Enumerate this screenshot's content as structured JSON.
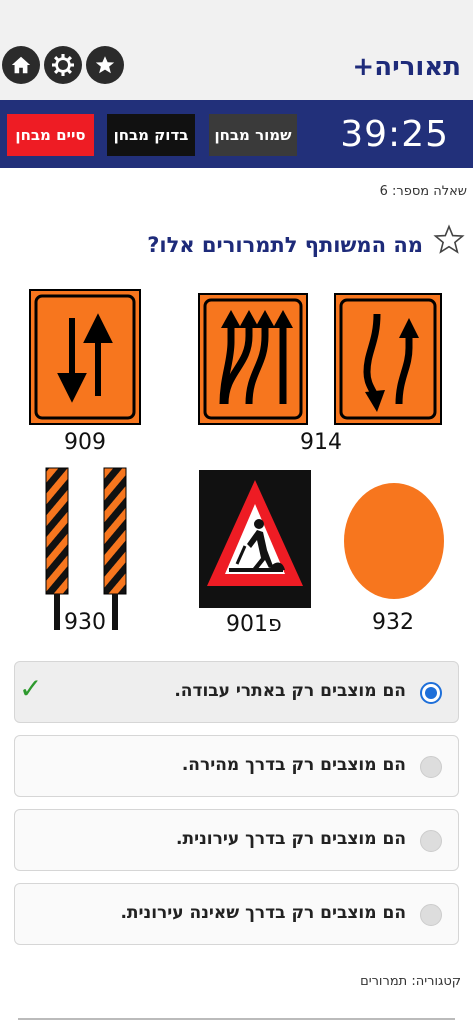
{
  "header": {
    "app_title": "תאוריה+",
    "icons": [
      "home-icon",
      "gear-icon",
      "star-icon"
    ]
  },
  "exam_bar": {
    "timer": "39:25",
    "save_label": "שמור מבחן",
    "check_label": "בדוק מבחן",
    "end_label": "סיים מבחן"
  },
  "question": {
    "number_label": "שאלה מספר: 6",
    "text": "מה המשותף לתמרורים אלו?"
  },
  "signs": [
    {
      "code": "909"
    },
    {
      "code": "914"
    },
    {
      "code": "930"
    },
    {
      "code": "901פ"
    },
    {
      "code": "932"
    }
  ],
  "answers": [
    {
      "text": "הם מוצבים רק באתרי עבודה.",
      "selected": true,
      "correct": true
    },
    {
      "text": "הם מוצבים רק בדרך מהירה.",
      "selected": false
    },
    {
      "text": "הם מוצבים רק בדרך עירונית.",
      "selected": false
    },
    {
      "text": "הם מוצבים רק בדרך שאינה עירונית.",
      "selected": false
    }
  ],
  "category_label": "קטגוריה: תמרורים",
  "colors": {
    "brand_blue": "#22307a",
    "sign_orange": "#f7761e",
    "end_red": "#ee1c24",
    "correct_green": "#2e9a2e"
  }
}
